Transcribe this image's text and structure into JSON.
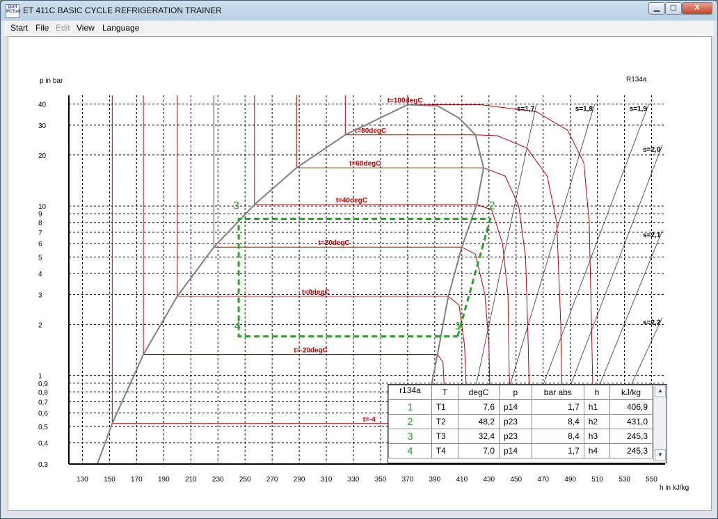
{
  "window": {
    "title": "ET 411C BASIC CYCLE REFRIGERATION TRAINER",
    "icon_text_1": "gunt",
    "icon_text_2": "PCTool",
    "minimize_glyph": "▁",
    "maximize_glyph": "▢",
    "close_glyph": "X"
  },
  "menu": [
    {
      "label": "Start",
      "enabled": true
    },
    {
      "label": "File",
      "enabled": true
    },
    {
      "label": "Edit",
      "enabled": false
    },
    {
      "label": "View",
      "enabled": true
    },
    {
      "label": "Language",
      "enabled": true
    }
  ],
  "chart_data": {
    "type": "line",
    "refrigerant": "R134a",
    "ylabel": "p in bar",
    "xlabel": "h in kJ/kg",
    "yscale": "log",
    "ylim": [
      0.3,
      45
    ],
    "xlim": [
      120,
      560
    ],
    "grid": true,
    "x_ticks": [
      130,
      150,
      170,
      190,
      210,
      230,
      250,
      270,
      290,
      310,
      330,
      350,
      370,
      390,
      410,
      430,
      450,
      470,
      490,
      510,
      530,
      550
    ],
    "y_ticks": [
      {
        "v": 0.3,
        "label": "0,3"
      },
      {
        "v": 0.4,
        "label": "0,4"
      },
      {
        "v": 0.5,
        "label": "0,5"
      },
      {
        "v": 0.6,
        "label": "0,6"
      },
      {
        "v": 0.7,
        "label": "0,7"
      },
      {
        "v": 0.8,
        "label": "0,8"
      },
      {
        "v": 0.9,
        "label": "0,9"
      },
      {
        "v": 1,
        "label": "1"
      },
      {
        "v": 2,
        "label": "2"
      },
      {
        "v": 3,
        "label": "3"
      },
      {
        "v": 4,
        "label": "4"
      },
      {
        "v": 5,
        "label": "5"
      },
      {
        "v": 6,
        "label": "6"
      },
      {
        "v": 7,
        "label": "7"
      },
      {
        "v": 8,
        "label": "8"
      },
      {
        "v": 9,
        "label": "9"
      },
      {
        "v": 10,
        "label": "10"
      },
      {
        "v": 20,
        "label": "20"
      },
      {
        "v": 30,
        "label": "30"
      },
      {
        "v": 40,
        "label": "40"
      }
    ],
    "saturation_liquid": [
      [
        141,
        0.3
      ],
      [
        152,
        0.52
      ],
      [
        175,
        1.33
      ],
      [
        200,
        2.93
      ],
      [
        227,
        5.72
      ],
      [
        257,
        10.2
      ],
      [
        288,
        16.8
      ],
      [
        324,
        26.3
      ],
      [
        370,
        39.6
      ]
    ],
    "saturation_vapor": [
      [
        370,
        39.6
      ],
      [
        392,
        39.0
      ],
      [
        408,
        33.0
      ],
      [
        420,
        26.3
      ],
      [
        426,
        16.8
      ],
      [
        421,
        10.2
      ],
      [
        410,
        5.72
      ],
      [
        400,
        2.93
      ],
      [
        392,
        1.33
      ],
      [
        382,
        0.52
      ],
      [
        377,
        0.3
      ]
    ],
    "isotherms": [
      {
        "label": "t=100degC",
        "h_liq": 370,
        "p": 39.6,
        "label_h": 355,
        "vap": [
          [
            392,
            39.6
          ],
          [
            424,
            39.6
          ],
          [
            465,
            36
          ],
          [
            488,
            28
          ],
          [
            500,
            18
          ],
          [
            504,
            8
          ],
          [
            506,
            1.5
          ],
          [
            507,
            0.6
          ]
        ]
      },
      {
        "label": "t=80degC",
        "h_liq": 324,
        "p": 26.3,
        "label_h": 331,
        "vap": [
          [
            420,
            26.3
          ],
          [
            436,
            26
          ],
          [
            458,
            22
          ],
          [
            473,
            15
          ],
          [
            480,
            8
          ],
          [
            483,
            2
          ],
          [
            484,
            0.6
          ]
        ]
      },
      {
        "label": "t=60degC",
        "h_liq": 288,
        "p": 16.8,
        "label_h": 327,
        "vap": [
          [
            426,
            16.8
          ],
          [
            442,
            15
          ],
          [
            452,
            10
          ],
          [
            457,
            5
          ],
          [
            459,
            1.5
          ],
          [
            460,
            0.6
          ]
        ]
      },
      {
        "label": "t=40degC",
        "h_liq": 257,
        "p": 10.2,
        "label_h": 317,
        "vap": [
          [
            421,
            10.2
          ],
          [
            432,
            9.5
          ],
          [
            440,
            6
          ],
          [
            444,
            3
          ],
          [
            445,
            1
          ],
          [
            446,
            0.6
          ]
        ]
      },
      {
        "label": "t=20degC",
        "h_liq": 227,
        "p": 5.72,
        "label_h": 304,
        "vap": [
          [
            410,
            5.72
          ],
          [
            420,
            5.2
          ],
          [
            427,
            3
          ],
          [
            430,
            1.5
          ],
          [
            431,
            0.6
          ]
        ]
      },
      {
        "label": "t=0degC",
        "h_liq": 200,
        "p": 2.93,
        "label_h": 292,
        "vap": [
          [
            400,
            2.93
          ],
          [
            408,
            2.6
          ],
          [
            412,
            1.5
          ],
          [
            414,
            0.6
          ]
        ]
      },
      {
        "label": "t=-20degC",
        "h_liq": 175,
        "p": 1.33,
        "label_h": 286,
        "vap": [
          [
            392,
            1.33
          ],
          [
            396,
            1.2
          ],
          [
            398,
            0.6
          ]
        ]
      },
      {
        "label": "t=-4",
        "h_liq": 152,
        "p": 0.52,
        "label_h": 337,
        "vap": []
      }
    ],
    "isentropes": [
      {
        "label": "s=1,7",
        "p1": [
          408,
          0.3
        ],
        "p2": [
          465,
          40
        ]
      },
      {
        "label": "s=1,8",
        "p1": [
          428,
          0.3
        ],
        "p2": [
          508,
          40
        ]
      },
      {
        "label": "s=1,9",
        "p1": [
          448,
          0.3
        ],
        "p2": [
          548,
          40
        ]
      },
      {
        "label": "s=2,0",
        "p1": [
          468,
          0.3
        ],
        "p2": [
          558,
          23
        ]
      },
      {
        "label": "s=2,1",
        "p1": [
          488,
          0.3
        ],
        "p2": [
          558,
          7.2
        ]
      },
      {
        "label": "s=2,2",
        "p1": [
          508,
          0.3
        ],
        "p2": [
          558,
          2.2
        ]
      }
    ],
    "cycle": {
      "points": [
        {
          "n": "1",
          "h": 406.9,
          "p": 1.7
        },
        {
          "n": "2",
          "h": 431.0,
          "p": 8.4
        },
        {
          "n": "3",
          "h": 245.3,
          "p": 8.4
        },
        {
          "n": "4",
          "h": 245.3,
          "p": 1.7
        }
      ],
      "color": "#2aa02a"
    },
    "colors": {
      "sat": "#808080",
      "iso": "#c00000",
      "grid": "#000000",
      "isentrope": "#333333"
    }
  },
  "table": {
    "refrigerant": "r134a",
    "headers": [
      "T",
      "degC",
      "p",
      "bar abs",
      "h",
      "kJ/kg"
    ],
    "rows": [
      {
        "n": "1",
        "T": "T1",
        "degC": "7,6",
        "p": "p14",
        "bar": "1,7",
        "h": "h1",
        "kj": "406,9"
      },
      {
        "n": "2",
        "T": "T2",
        "degC": "48,2",
        "p": "p23",
        "bar": "8,4",
        "h": "h2",
        "kj": "431,0"
      },
      {
        "n": "3",
        "T": "T3",
        "degC": "32,4",
        "p": "p23",
        "bar": "8,4",
        "h": "h3",
        "kj": "245,3"
      },
      {
        "n": "4",
        "T": "T4",
        "degC": "7,0",
        "p": "p14",
        "bar": "1,7",
        "h": "h4",
        "kj": "245,3"
      }
    ],
    "scroll_up": "▲",
    "scroll_down": "▼"
  }
}
